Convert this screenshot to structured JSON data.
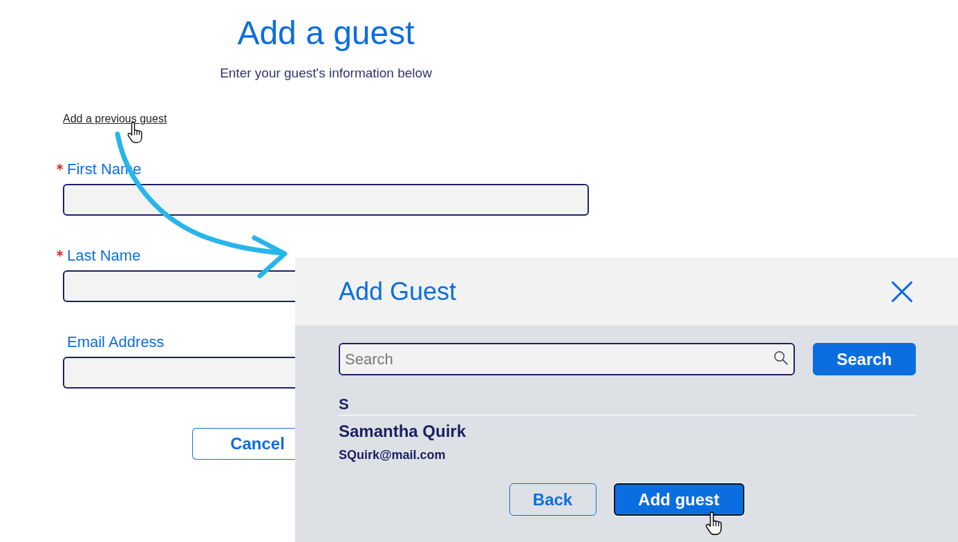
{
  "page": {
    "title": "Add a guest",
    "subtitle": "Enter your guest's information below",
    "previous_guest_link": "Add a previous guest",
    "fields": [
      {
        "label": "First Name",
        "required": true
      },
      {
        "label": "Last Name",
        "required": true
      },
      {
        "label": "Email Address",
        "required": false
      }
    ],
    "buttons": [
      {
        "label": "Cancel",
        "kind": "secondary",
        "focused": false
      }
    ]
  },
  "dialog": {
    "title": "Add Guest",
    "search": {
      "placeholder": "Search"
    },
    "search_button": "Search",
    "groups": [
      {
        "letter": "S",
        "guests": [
          {
            "name": "Samantha Quirk",
            "email": "SQuirk@mail.com"
          }
        ]
      }
    ],
    "buttons": [
      {
        "label": "Back",
        "kind": "secondary",
        "focused": false
      },
      {
        "label": "Add guest",
        "kind": "primary",
        "focused": true
      }
    ]
  }
}
